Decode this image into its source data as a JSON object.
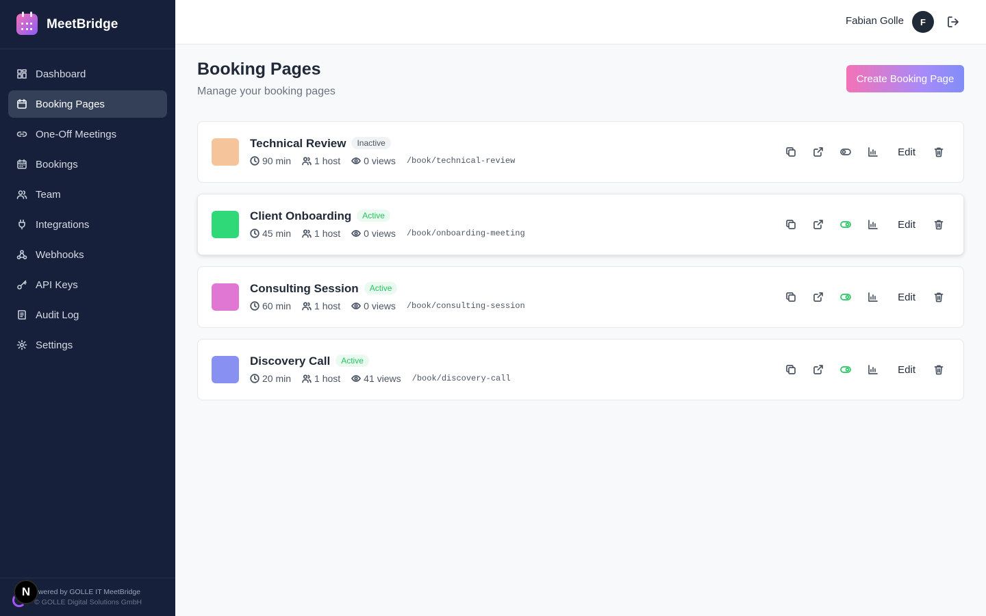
{
  "app": {
    "name": "MeetBridge"
  },
  "sidebar": {
    "items": [
      {
        "label": "Dashboard",
        "icon": "dashboard-icon"
      },
      {
        "label": "Booking Pages",
        "icon": "calendar-icon",
        "active": true
      },
      {
        "label": "One-Off Meetings",
        "icon": "link-icon"
      },
      {
        "label": "Bookings",
        "icon": "calendar-grid-icon"
      },
      {
        "label": "Team",
        "icon": "users-icon"
      },
      {
        "label": "Integrations",
        "icon": "plug-icon"
      },
      {
        "label": "Webhooks",
        "icon": "webhook-icon"
      },
      {
        "label": "API Keys",
        "icon": "key-icon"
      },
      {
        "label": "Audit Log",
        "icon": "audit-log-icon"
      },
      {
        "label": "Settings",
        "icon": "gear-icon"
      }
    ],
    "footer": {
      "powered_by": "owered by GOLLE IT MeetBridge",
      "copyright": "© GOLLE Digital Solutions GmbH",
      "badge": "N"
    }
  },
  "header": {
    "user_name": "Fabian Golle",
    "avatar_initial": "F"
  },
  "main": {
    "title": "Booking Pages",
    "subtitle": "Manage your booking pages",
    "create_label": "Create Booking Page",
    "pages": [
      {
        "title": "Technical Review",
        "status": "Inactive",
        "active": false,
        "color": "#f6c49a",
        "duration": "90 min",
        "hosts": "1 host",
        "views": "0 views",
        "slug": "/book/technical-review"
      },
      {
        "title": "Client Onboarding",
        "status": "Active",
        "active": true,
        "color": "#2fd978",
        "duration": "45 min",
        "hosts": "1 host",
        "views": "0 views",
        "slug": "/book/onboarding-meeting"
      },
      {
        "title": "Consulting Session",
        "status": "Active",
        "active": true,
        "color": "#e077d3",
        "duration": "60 min",
        "hosts": "1 host",
        "views": "0 views",
        "slug": "/book/consulting-session"
      },
      {
        "title": "Discovery Call",
        "status": "Active",
        "active": true,
        "color": "#8890f2",
        "duration": "20 min",
        "hosts": "1 host",
        "views": "41 views",
        "slug": "/book/discovery-call"
      }
    ],
    "edit_label": "Edit"
  }
}
